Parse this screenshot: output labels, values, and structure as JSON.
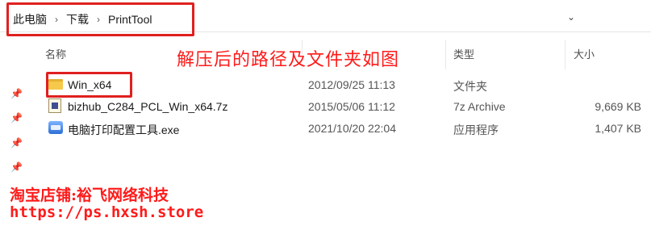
{
  "address_bar": {
    "crumbs": [
      "此电脑",
      "下载",
      "PrintTool"
    ],
    "separator": "›",
    "dropdown_icon": "chevron-down-icon"
  },
  "columns": {
    "name": "名称",
    "type": "类型",
    "size": "大小"
  },
  "annotation": "解压后的路径及文件夹如图",
  "files": [
    {
      "name": "Win_x64",
      "date": "2012/09/25 11:13",
      "type": "文件夹",
      "size": "",
      "icon": "folder-icon"
    },
    {
      "name": "bizhub_C284_PCL_Win_x64.7z",
      "date": "2015/05/06 11:12",
      "type": "7z Archive",
      "size": "9,669 KB",
      "icon": "archive-icon"
    },
    {
      "name": "电脑打印配置工具.exe",
      "date": "2021/10/20 22:04",
      "type": "应用程序",
      "size": "1,407 KB",
      "icon": "exe-icon"
    }
  ],
  "footer": {
    "shop_line": "淘宝店铺:裕飞网络科技",
    "url_line": "https://ps.hxsh.store"
  },
  "colors": {
    "highlight_red": "#e02020",
    "annotation_red": "#ff1a1a",
    "folder_yellow": "#f6c94a"
  }
}
